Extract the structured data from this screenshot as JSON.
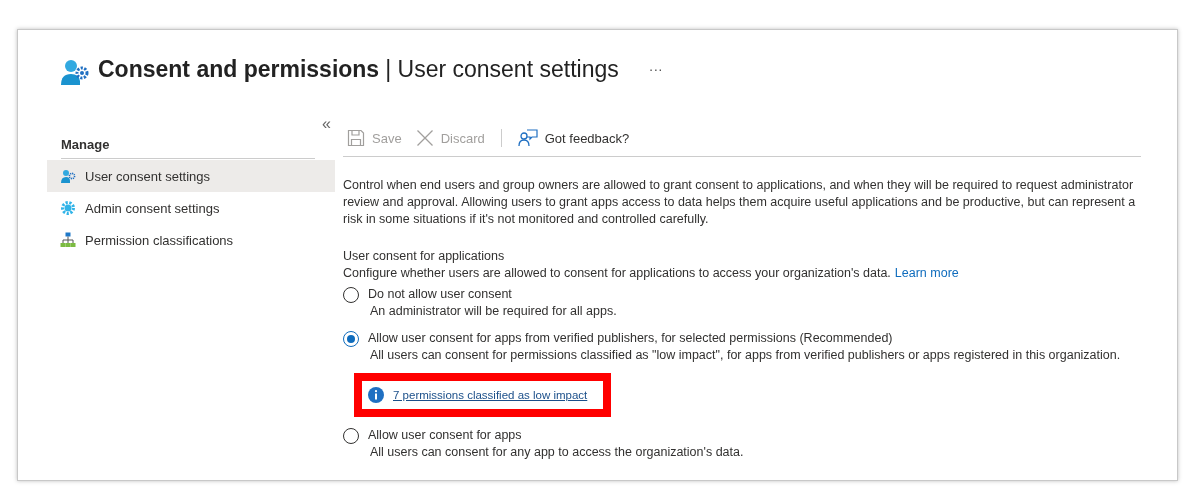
{
  "header": {
    "title": "Consent and permissions",
    "separator": "|",
    "subtitle": "User consent settings",
    "more": "···"
  },
  "sidebar": {
    "collapse": "«",
    "section": "Manage",
    "items": [
      {
        "label": "User consent settings",
        "kind": "consent",
        "selected": true
      },
      {
        "label": "Admin consent settings",
        "kind": "admin",
        "selected": false
      },
      {
        "label": "Permission classifications",
        "kind": "classification",
        "selected": false
      }
    ]
  },
  "toolbar": [
    {
      "label": "Save",
      "kind": "save",
      "disabled": true
    },
    {
      "label": "Discard",
      "kind": "discard",
      "disabled": true
    },
    {
      "label": "Got feedback?",
      "kind": "feedback",
      "disabled": false
    }
  ],
  "description": "Control when end users and group owners are allowed to grant consent to applications, and when they will be required to request administrator review and approval. Allowing users to grant apps access to data helps them acquire useful applications and be productive, but can represent a risk in some situations if it's not monitored and controlled carefully.",
  "consent": {
    "heading": "User consent for applications",
    "help": "Configure whether users are allowed to consent for applications to access your organization's data.",
    "learn_more": "Learn more",
    "options": [
      {
        "label": "Do not allow user consent",
        "detail": "An administrator will be required for all apps.",
        "selected": false
      },
      {
        "label": "Allow user consent for apps from verified publishers, for selected permissions (Recommended)",
        "detail": "All users can consent for permissions classified as \"low impact\", for apps from verified publishers or apps registered in this organization.",
        "selected": true,
        "info_link": {
          "text": "7 permissions classified as low impact",
          "highlighted": true
        }
      },
      {
        "label": "Allow user consent for apps",
        "detail": "All users can consent for any app to access the organization's data.",
        "selected": false
      }
    ]
  }
}
